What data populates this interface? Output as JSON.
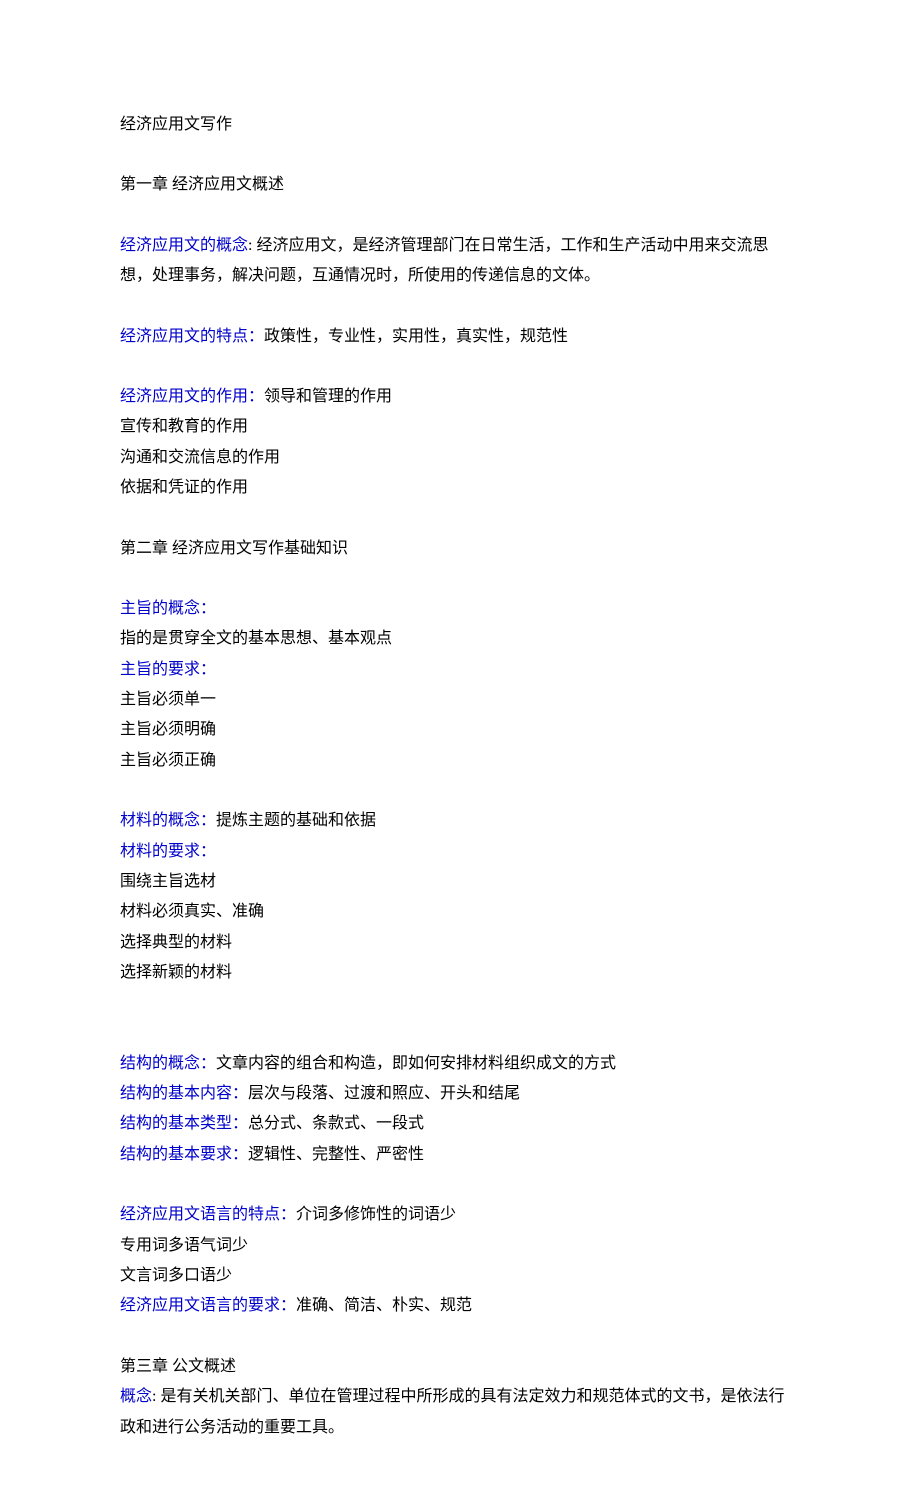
{
  "title": "经济应用文写作",
  "ch1": {
    "heading": "第一章  经济应用文概述",
    "concept_label": "经济应用文的概念",
    "concept_text": ": 经济应用文，是经济管理部门在日常生活，工作和生产活动中用来交流思想，处理事务，解决问题，互通情况时，所使用的传递信息的文体。",
    "features_label": "经济应用文的特点：",
    "features_text": "政策性，专业性，实用性，真实性，规范性",
    "roles_label": "经济应用文的作用：",
    "roles": [
      "领导和管理的作用",
      "宣传和教育的作用",
      "沟通和交流信息的作用",
      "依据和凭证的作用"
    ]
  },
  "ch2": {
    "heading": "第二章  经济应用文写作基础知识",
    "topic_concept_label": "主旨的概念：",
    "topic_concept_text": "指的是贯穿全文的基本思想、基本观点",
    "topic_req_label": "主旨的要求：",
    "topic_reqs": [
      "主旨必须单一",
      "主旨必须明确",
      "主旨必须正确"
    ],
    "material_concept_label": "材料的概念：",
    "material_concept_text": "提炼主题的基础和依据",
    "material_req_label": "材料的要求：",
    "material_reqs": [
      "围绕主旨选材",
      "材料必须真实、准确",
      "选择典型的材料",
      "选择新颖的材料"
    ],
    "structure_concept_label": "结构的概念：",
    "structure_concept_text": "文章内容的组合和构造，即如何安排材料组织成文的方式",
    "structure_content_label": "结构的基本内容：",
    "structure_content_text": "层次与段落、过渡和照应、开头和结尾",
    "structure_type_label": "结构的基本类型：",
    "structure_type_text": "总分式、条款式、一段式",
    "structure_req_label": "结构的基本要求：",
    "structure_req_text": "逻辑性、完整性、严密性",
    "lang_feature_label": "经济应用文语言的特点：",
    "lang_features": [
      "介词多修饰性的词语少",
      "专用词多语气词少",
      "文言词多口语少"
    ],
    "lang_req_label": "经济应用文语言的要求：",
    "lang_req_text": "准确、简洁、朴实、规范"
  },
  "ch3": {
    "heading": "第三章  公文概述",
    "concept_label": "概念",
    "concept_text": ": 是有关机关部门、单位在管理过程中所形成的具有法定效力和规范体式的文书，是依法行政和进行公务活动的重要工具。"
  }
}
